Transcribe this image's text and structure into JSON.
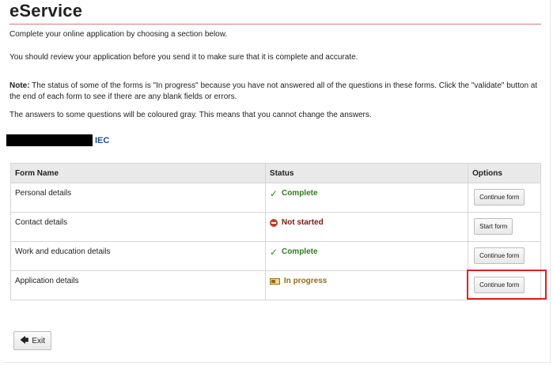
{
  "header": {
    "title": "eService"
  },
  "intro": {
    "line1": "Complete your online application by choosing a section below.",
    "line2": "You should review your application before you send it to make sure that it is complete and accurate.",
    "note_label": "Note:",
    "note_text": " The status of some of the forms is \"In progress\" because you have not answered all of the questions in these forms. Click the \"validate\" button at the end of each form to see if there are any blank fields or errors.",
    "gray_note": "The answers to some questions will be coloured gray. This means that you cannot change the answers."
  },
  "applicant": {
    "suffix": "IEC"
  },
  "table": {
    "headers": {
      "name": "Form Name",
      "status": "Status",
      "options": "Options"
    },
    "rows": [
      {
        "name": "Personal details",
        "status": "Complete",
        "status_type": "complete",
        "status_icon": "check-icon",
        "button": "Continue form"
      },
      {
        "name": "Contact details",
        "status": "Not started",
        "status_type": "not-started",
        "status_icon": "no-entry-icon",
        "button": "Start form"
      },
      {
        "name": "Work and education details",
        "status": "Complete",
        "status_type": "complete",
        "status_icon": "check-icon",
        "button": "Continue form"
      },
      {
        "name": "Application details",
        "status": "In progress",
        "status_type": "in-progress",
        "status_icon": "progress-icon",
        "button": "Continue form"
      }
    ]
  },
  "footer": {
    "exit_label": "Exit",
    "exit_icon": "arrow-left-icon"
  },
  "colors": {
    "complete": "#2e7d1e",
    "not_started": "#7a1b10",
    "in_progress": "#9a6a12",
    "highlight": "#e02020",
    "title_rule": "#d27a7a"
  }
}
